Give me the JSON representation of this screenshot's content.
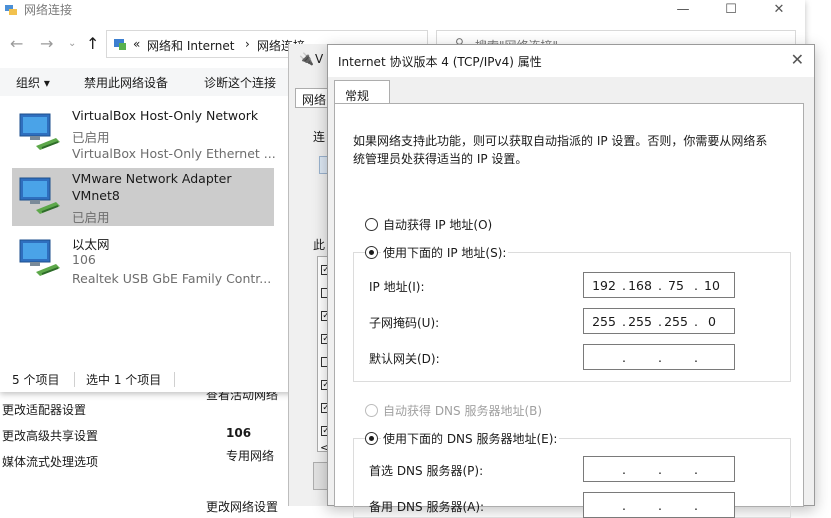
{
  "bg_window": {
    "links": [
      "更改适配器设置",
      "更改高级共享设置",
      "媒体流式处理选项"
    ],
    "active_label": "查看活动网络",
    "network_name": "106",
    "network_type": "专用网络",
    "bottom_partial": "更改网络设置"
  },
  "ncw": {
    "title": "网络连接",
    "breadcrumb": [
      "«",
      "网络和 Internet",
      "›",
      "网络连接"
    ],
    "search_placeholder": "搜索\"网络连接\"",
    "commands": [
      "组织 ▾",
      "禁用此网络设备",
      "诊断这个连接"
    ],
    "items": [
      {
        "name": "VirtualBox Host-Only Network",
        "status": "已启用",
        "device": "VirtualBox Host-Only Ethernet ..."
      },
      {
        "name": "VMware Network Adapter",
        "name2": "VMnet8",
        "status": "已启用",
        "device": ""
      },
      {
        "name": "以太网",
        "status": "106",
        "device": "Realtek USB GbE Family Contr..."
      }
    ],
    "status_count": "5 个项目",
    "status_selected": "选中 1 个项目"
  },
  "mid_dialog": {
    "title_partial": "V",
    "tab_partial": "网络",
    "label1": "连",
    "label2": "此",
    "button_partial": "<"
  },
  "ipv4": {
    "title": "Internet 协议版本 4 (TCP/IPv4) 属性",
    "tab": "常规",
    "description": "如果网络支持此功能，则可以获取自动指派的 IP 设置。否则，你需要从网络系统管理员处获得适当的 IP 设置。",
    "auto_ip": "自动获得 IP 地址(O)",
    "manual_ip": "使用下面的 IP 地址(S):",
    "ip_label": "IP 地址(I):",
    "ip": [
      "192",
      "168",
      "75",
      "10"
    ],
    "mask_label": "子网掩码(U):",
    "mask": [
      "255",
      "255",
      "255",
      "0"
    ],
    "gw_label": "默认网关(D):",
    "auto_dns": "自动获得 DNS 服务器地址(B)",
    "manual_dns": "使用下面的 DNS 服务器地址(E):",
    "dns1_label": "首选 DNS 服务器(P):",
    "dns2_label": "备用 DNS 服务器(A):"
  }
}
